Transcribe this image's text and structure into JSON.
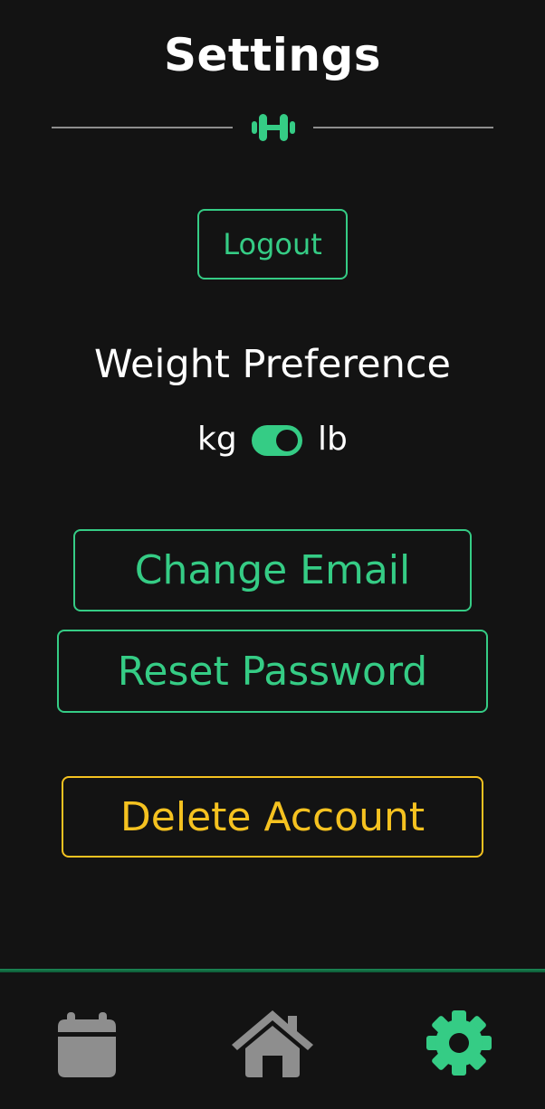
{
  "header": {
    "title": "Settings"
  },
  "actions": {
    "logout_label": "Logout",
    "change_email_label": "Change Email",
    "reset_password_label": "Reset Password",
    "delete_account_label": "Delete Account"
  },
  "weight_preference": {
    "heading": "Weight Preference",
    "left_unit": "kg",
    "right_unit": "lb",
    "selected": "lb",
    "toggle_on": true
  },
  "nav": {
    "items": [
      {
        "icon": "calendar-icon",
        "active": false
      },
      {
        "icon": "home-icon",
        "active": false
      },
      {
        "icon": "gear-icon",
        "active": true
      }
    ]
  },
  "colors": {
    "background": "#131313",
    "accent_green": "#35cc85",
    "warning_yellow": "#f5c220",
    "inactive_icon": "#8e8e8e",
    "text": "#ffffff"
  }
}
